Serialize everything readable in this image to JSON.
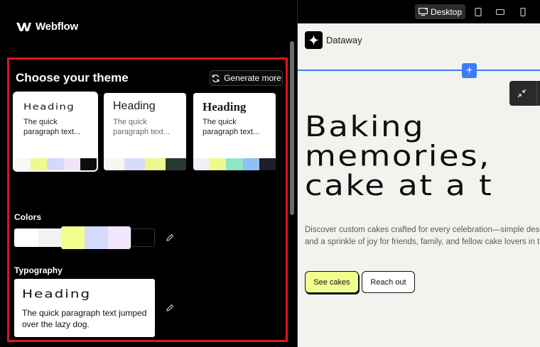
{
  "sidebar": {
    "logo_text": "Webflow",
    "theme_section": {
      "title": "Choose your theme",
      "generate_label": "Generate more",
      "cards": [
        {
          "heading": "Heading",
          "paragraph": "The quick paragraph text...",
          "swatches": [
            "#f7f7f5",
            "#eefa8c",
            "#d4d9fb",
            "#efe4fa",
            "#0d0d0d"
          ]
        },
        {
          "heading": "Heading",
          "paragraph": "The quick paragraph text...",
          "swatches": [
            "#f7f6f3",
            "#d6dcf8",
            "#edf890",
            "#27392e"
          ]
        },
        {
          "heading": "Heading",
          "paragraph": "The quick paragraph text...",
          "swatches": [
            "#eef2f8",
            "#eefa8c",
            "#8fe8c4",
            "#8ec2f6",
            "#1b1f26"
          ]
        }
      ]
    },
    "colors_label": "Colors",
    "palette": [
      "#ffffff",
      "#f2f2f2",
      "#f2ff8f",
      "#d4dafc",
      "#f1e6fb",
      "#000000"
    ],
    "typography_label": "Typography",
    "typography": {
      "heading": "Heading",
      "paragraph": "The quick paragraph text jumped over the lazy dog."
    }
  },
  "preview": {
    "view_modes": {
      "desktop_label": "Desktop",
      "icons": [
        "desktop-icon",
        "tablet-icon",
        "tablet-landscape-icon",
        "mobile-icon"
      ]
    },
    "site_name": "Dataway",
    "hero": {
      "title_lines": [
        "Baking",
        "memories,",
        "cake at a t"
      ],
      "description_lines": [
        "Discover custom cakes crafted for every celebration—simple desig",
        "and a sprinkle of joy for friends, family, and fellow cake lovers in the"
      ],
      "primary_cta": "See cakes",
      "secondary_cta": "Reach out"
    }
  },
  "colors": {
    "accent_blue": "#3e7bfa",
    "highlight_red": "#e0141e",
    "lime": "#f2ff8f"
  }
}
